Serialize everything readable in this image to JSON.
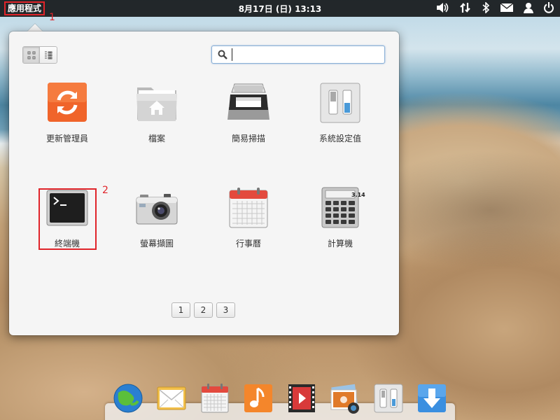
{
  "top_panel": {
    "applications_label": "應用程式",
    "clock": "8月17日 (日) 13:13",
    "indicators": [
      "sound-icon",
      "network-icon",
      "bluetooth-icon",
      "mail-icon",
      "user-icon",
      "power-icon"
    ]
  },
  "annotations": {
    "step1": "1",
    "step2": "2"
  },
  "launcher": {
    "search": {
      "value": "",
      "placeholder": ""
    },
    "view_modes": [
      "grid-view-icon",
      "category-view-icon"
    ],
    "apps": [
      {
        "label": "更新管理員",
        "icon": "update-manager-icon"
      },
      {
        "label": "檔案",
        "icon": "files-folder-icon"
      },
      {
        "label": "簡易掃描",
        "icon": "scanner-icon"
      },
      {
        "label": "系統設定值",
        "icon": "system-settings-icon"
      },
      {
        "label": "終端機",
        "icon": "terminal-icon"
      },
      {
        "label": "螢幕擷圖",
        "icon": "screenshot-camera-icon"
      },
      {
        "label": "行事曆",
        "icon": "calendar-icon"
      },
      {
        "label": "計算機",
        "icon": "calculator-icon"
      }
    ],
    "calculator_display": "3.14",
    "pages": [
      "1",
      "2",
      "3"
    ]
  },
  "dock": {
    "items": [
      "browser-globe-icon",
      "mail-envelope-icon",
      "calendar-icon",
      "music-note-icon",
      "video-player-icon",
      "photos-icon",
      "switchboard-settings-icon",
      "download-icon"
    ]
  },
  "colors": {
    "panel": "#1c1c1c",
    "highlight_box": "#e0242a",
    "update_orange": "#f0642a"
  }
}
